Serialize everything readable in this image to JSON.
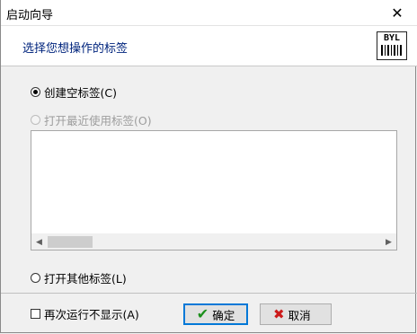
{
  "window": {
    "title": "启动向导"
  },
  "header": {
    "text": "选择您想操作的标签",
    "logo_text": "BYL"
  },
  "options": {
    "create_blank": "创建空标签(C)",
    "open_recent": "打开最近使用标签(O)",
    "open_other": "打开其他标签(L)"
  },
  "footer": {
    "dont_show": "再次运行不显示(A)",
    "ok": "确定",
    "cancel": "取消"
  }
}
